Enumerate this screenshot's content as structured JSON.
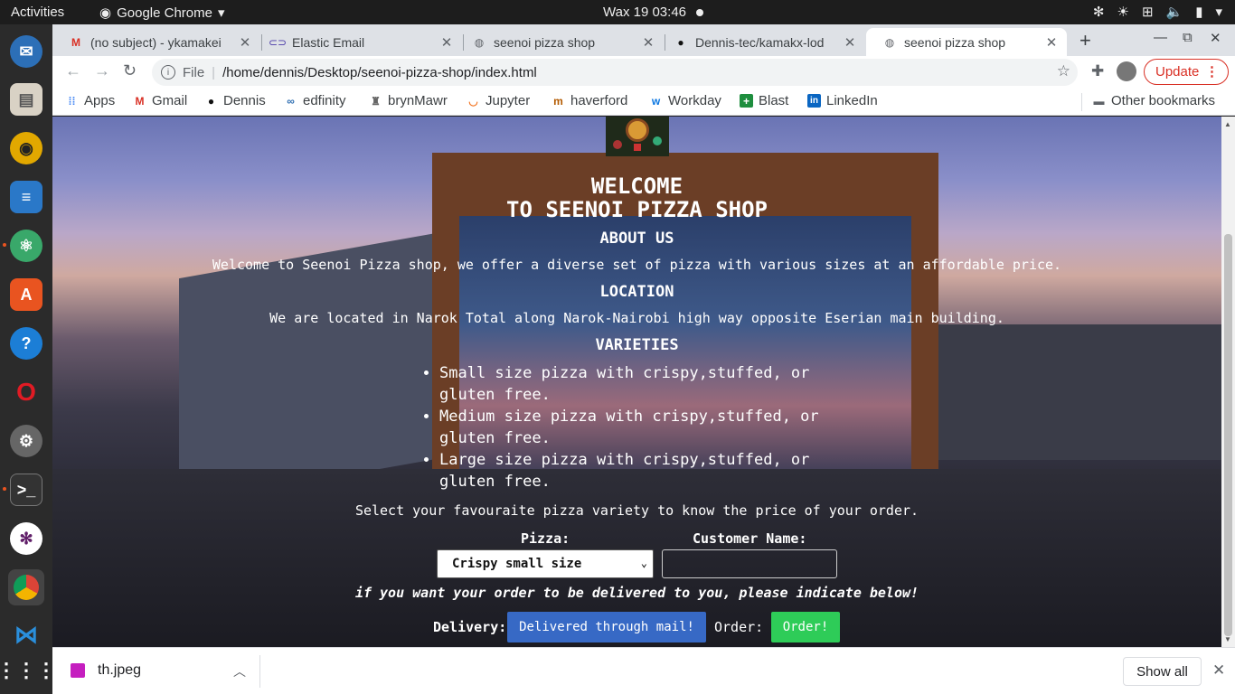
{
  "system": {
    "activities": "Activities",
    "app_name": "Google Chrome",
    "clock": "Wax 19  03:46"
  },
  "tabs": [
    {
      "title": "(no subject) - ykamakei",
      "icon": "gmail-icon"
    },
    {
      "title": "Elastic Email",
      "icon": "link-icon"
    },
    {
      "title": "seenoi pizza shop",
      "icon": "globe-icon"
    },
    {
      "title": "Dennis-tec/kamakx-lod",
      "icon": "github-icon"
    },
    {
      "title": "seenoi pizza shop",
      "icon": "globe-icon",
      "active": true
    }
  ],
  "toolbar": {
    "file_label": "File",
    "url": "/home/dennis/Desktop/seenoi-pizza-shop/index.html",
    "update_label": "Update"
  },
  "bookmarks": [
    {
      "label": "Apps",
      "icon": "apps-grid-icon"
    },
    {
      "label": "Gmail",
      "icon": "gmail-icon"
    },
    {
      "label": "Dennis",
      "icon": "github-icon"
    },
    {
      "label": "edfinity",
      "icon": "edfinity-icon"
    },
    {
      "label": "brynMawr",
      "icon": "brynmawr-icon"
    },
    {
      "label": "Jupyter",
      "icon": "jupyter-icon"
    },
    {
      "label": "haverford",
      "icon": "haverford-icon"
    },
    {
      "label": "Workday",
      "icon": "workday-icon"
    },
    {
      "label": "Blast",
      "icon": "blast-icon"
    },
    {
      "label": "LinkedIn",
      "icon": "linkedin-icon"
    }
  ],
  "other_bookmarks": "Other bookmarks",
  "page": {
    "welcome_line1": "WELCOME",
    "welcome_line2": "TO SEENOI PIZZA SHOP",
    "about_heading": "ABOUT US",
    "about_text": "Welcome to Seenoi Pizza shop, we offer a diverse set of pizza with various sizes at an affordable price.",
    "location_heading": "LOCATION",
    "location_text": "We are located in Narok Total along Narok-Nairobi high way opposite Eserian main building.",
    "varieties_heading": "VARIETIES",
    "varieties": [
      "Small size pizza with crispy,stuffed, or gluten free.",
      "Medium size pizza with crispy,stuffed, or gluten free.",
      "Large size pizza with crispy,stuffed, or gluten free."
    ],
    "select_text": "Select your favouraite pizza variety to know the price of your order.",
    "pizza_label": "Pizza:",
    "pizza_selected": "Crispy small size",
    "customer_label": "Customer Name:",
    "customer_value": "",
    "delivery_note": "if you want your order to be delivered to you, please indicate below!",
    "delivery_label": "Delivery:",
    "delivery_button": "Delivered through mail!",
    "order_label": "Order:",
    "order_button": "Order!"
  },
  "downloads": {
    "file_name": "th.jpeg",
    "show_all": "Show all"
  },
  "colors": {
    "delivery_button": "#3769c5",
    "order_button": "#2ecc58",
    "update_accent": "#d93025"
  }
}
